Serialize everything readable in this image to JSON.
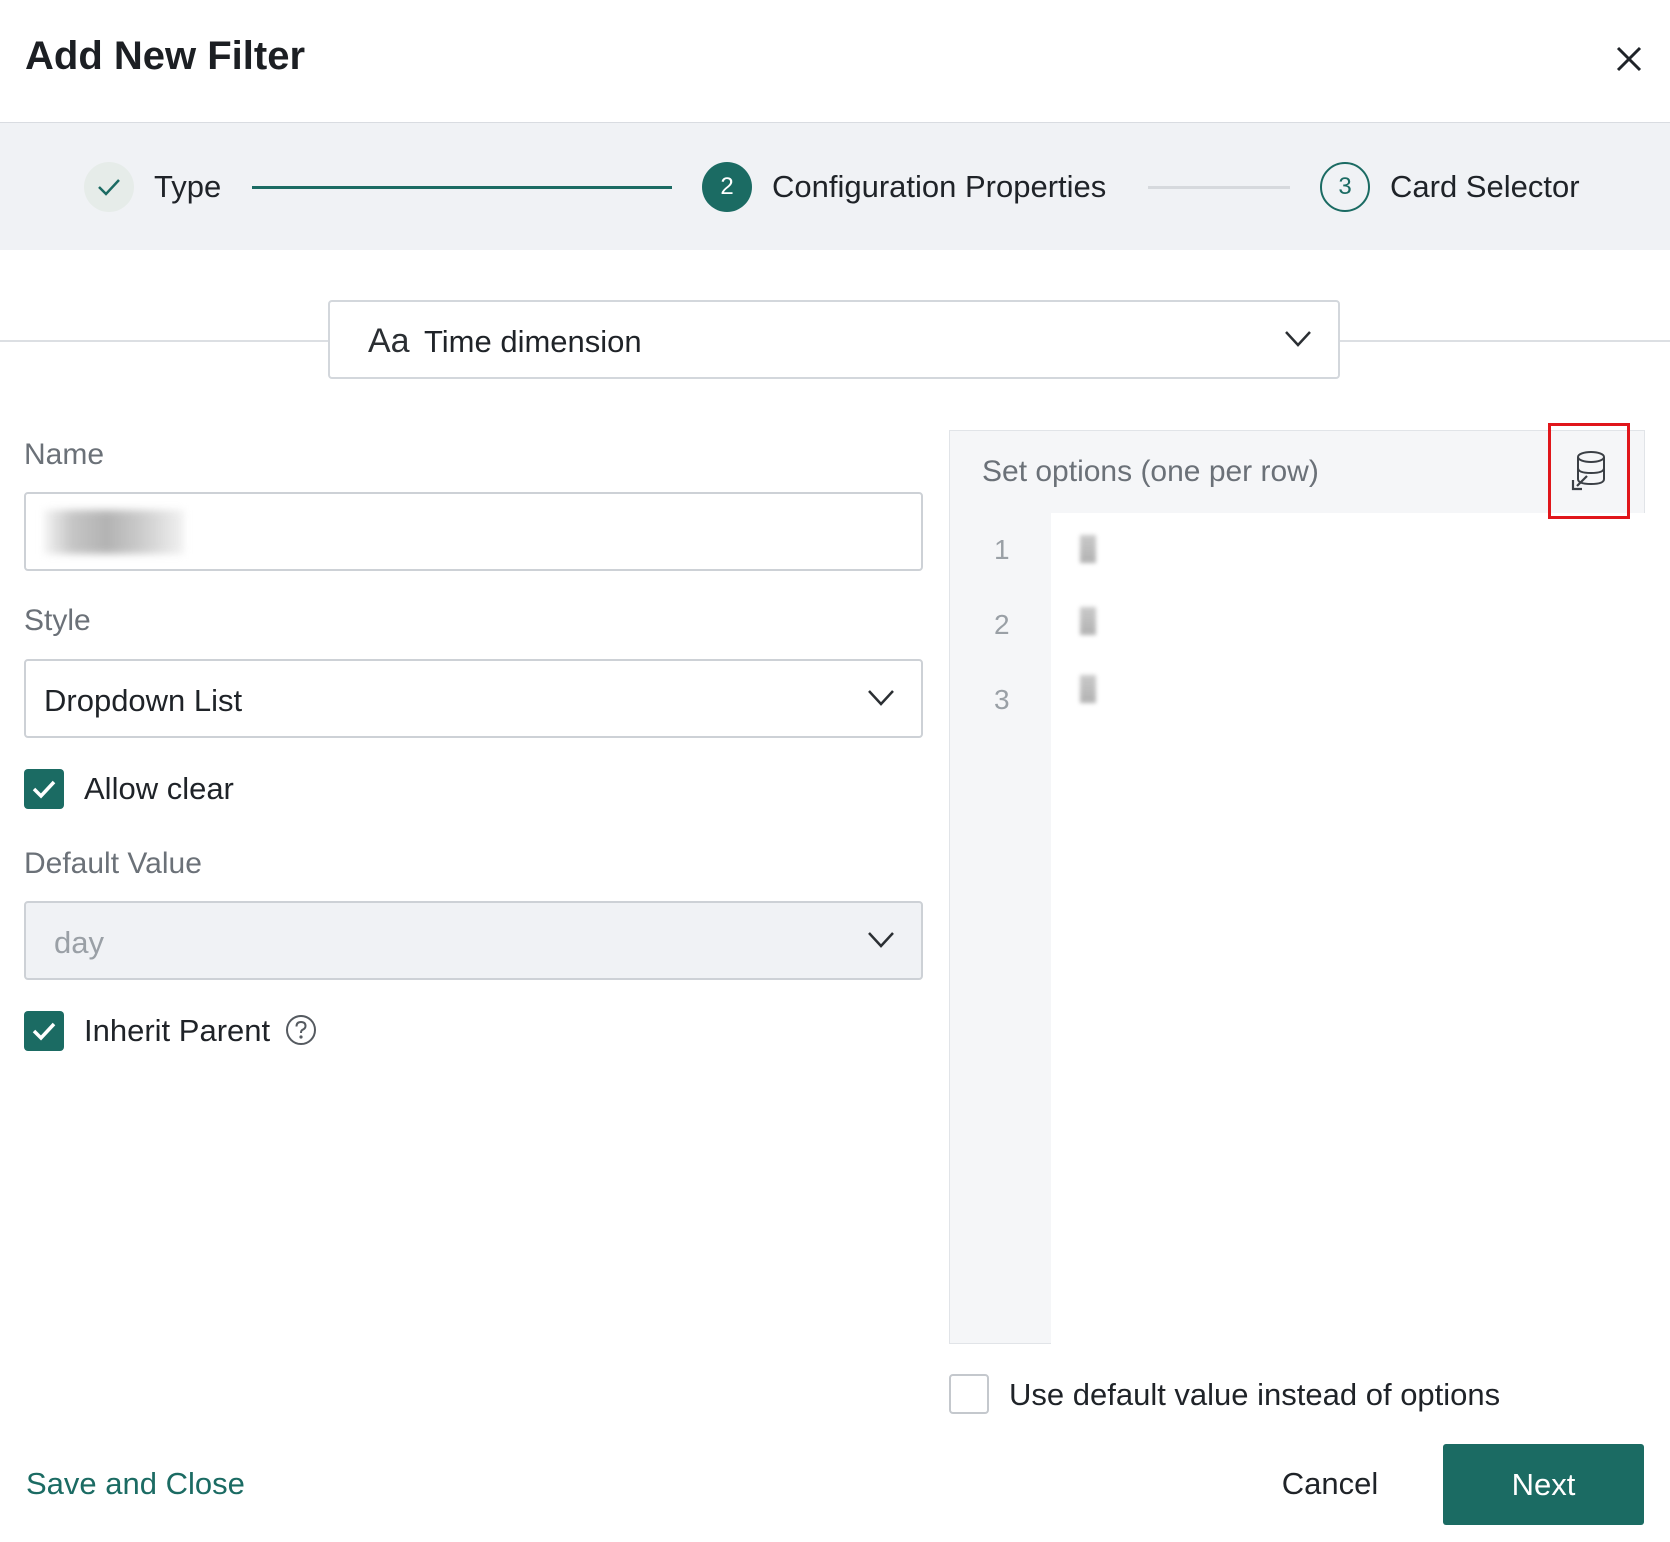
{
  "dialog": {
    "title": "Add New Filter",
    "close_icon": "close-icon"
  },
  "stepper": {
    "steps": [
      {
        "label": "Type",
        "state": "completed",
        "icon": "check-icon"
      },
      {
        "label": "Configuration Properties",
        "state": "active",
        "number": "2"
      },
      {
        "label": "Card Selector",
        "state": "pending",
        "number": "3"
      }
    ]
  },
  "type_select": {
    "icon": "text-type-icon",
    "icon_text": "Aa",
    "value": "Time dimension"
  },
  "form": {
    "name": {
      "label": "Name",
      "value": ""
    },
    "style": {
      "label": "Style",
      "value": "Dropdown List"
    },
    "allow_clear": {
      "label": "Allow clear",
      "checked": true
    },
    "default_value": {
      "label": "Default Value",
      "value": "day",
      "disabled": true
    },
    "inherit_parent": {
      "label": "Inherit Parent",
      "checked": true,
      "help_icon": "question-circle-icon"
    }
  },
  "options": {
    "header": "Set options (one per row)",
    "import_icon": "database-import-icon",
    "line_numbers": [
      "1",
      "2",
      "3"
    ]
  },
  "use_default": {
    "label": "Use default value instead of options",
    "checked": false
  },
  "footer": {
    "save_close": "Save and Close",
    "cancel": "Cancel",
    "next": "Next"
  },
  "colors": {
    "primary": "#1b6b63",
    "highlight_border": "#e0161b",
    "stepper_bg": "#f0f2f5"
  }
}
